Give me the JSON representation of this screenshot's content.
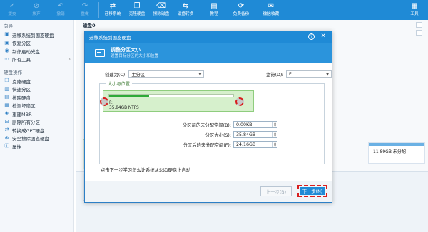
{
  "toolbar": {
    "items": [
      {
        "label": "提交",
        "icon": "check-icon",
        "enabled": false
      },
      {
        "label": "放弃",
        "icon": "discard-icon",
        "enabled": false
      },
      {
        "label": "撤销",
        "icon": "undo-icon",
        "enabled": false
      },
      {
        "label": "重做",
        "icon": "redo-icon",
        "enabled": false
      },
      {
        "label": "迁移系统",
        "icon": "migrate-os-icon",
        "enabled": true
      },
      {
        "label": "克隆硬盘",
        "icon": "clone-disk-icon",
        "enabled": true
      },
      {
        "label": "擦除磁盘",
        "icon": "wipe-disk-icon",
        "enabled": true
      },
      {
        "label": "磁盘转换",
        "icon": "convert-disk-icon",
        "enabled": true
      },
      {
        "label": "教程",
        "icon": "tutorial-icon",
        "enabled": true
      },
      {
        "label": "免费备份",
        "icon": "backup-icon",
        "enabled": true
      },
      {
        "label": "微信收藏",
        "icon": "wechat-icon",
        "enabled": true
      }
    ],
    "tools_label": "工具",
    "colors": {
      "bar": "#1f8ad6"
    }
  },
  "sidebar": {
    "section1": "向导",
    "wizard_items": [
      {
        "label": "迁移系统到固态硬盘",
        "icon": "migrate-icon"
      },
      {
        "label": "恢复分区",
        "icon": "recover-icon"
      },
      {
        "label": "制作启动光盘",
        "icon": "bootable-media-icon"
      },
      {
        "label": "所有工具",
        "icon": "all-tools-icon"
      }
    ],
    "section2": "硬盘操作",
    "disk_items": [
      {
        "label": "克隆硬盘",
        "icon": "clone-icon"
      },
      {
        "label": "快速分区",
        "icon": "quick-partition-icon"
      },
      {
        "label": "擦除硬盘",
        "icon": "wipe-icon"
      },
      {
        "label": "检测坏扇区",
        "icon": "bad-sector-icon"
      },
      {
        "label": "重建MBR",
        "icon": "rebuild-mbr-icon"
      },
      {
        "label": "删除所有分区",
        "icon": "delete-all-icon"
      },
      {
        "label": "转换成GPT硬盘",
        "icon": "convert-gpt-icon"
      },
      {
        "label": "安全擦除固态硬盘",
        "icon": "secure-erase-icon"
      },
      {
        "label": "属性",
        "icon": "properties-icon"
      }
    ]
  },
  "main": {
    "disk_title": "磁盘0",
    "right_card": {
      "text": "11.89GB 未分配"
    }
  },
  "dialog": {
    "title": "迁移系统到固态硬盘",
    "header_title": "调整分区大小",
    "header_subtitle": "设置目标分区的大小和位置",
    "create_as_label": "创建为(C):",
    "create_as_value": "主分区",
    "drive_letter_label": "盘符(D):",
    "drive_letter_value": "F:",
    "group_title": "大小与位置",
    "partition": {
      "letter": "F:",
      "info": "35.84GB NTFS",
      "used_fraction": 0.32
    },
    "fields": [
      {
        "label": "分区前的未分配空间(B):",
        "value": "0.00KB"
      },
      {
        "label": "分区大小(S):",
        "value": "35.84GB"
      },
      {
        "label": "分区后的未分配空间(F):",
        "value": "24.16GB"
      }
    ],
    "hint": "点击下一步学习怎么让系统从SSD硬盘上启动",
    "prev_button": "上一步(B)",
    "next_button": "下一步(N)"
  }
}
